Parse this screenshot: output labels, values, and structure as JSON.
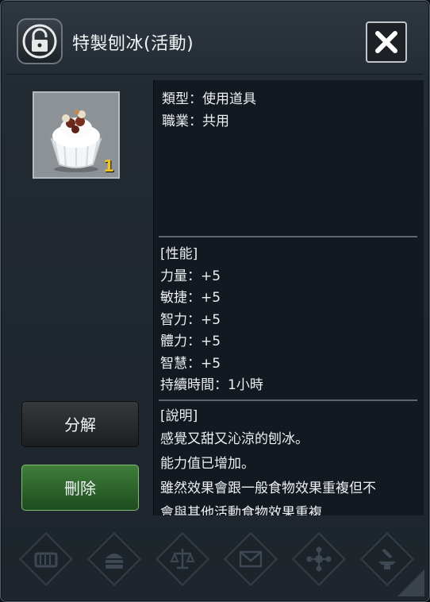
{
  "window": {
    "title": "特製刨冰(活動)",
    "icon": "lock-icon",
    "close_icon": "close-icon"
  },
  "item": {
    "icon": "shaved-ice-icon",
    "count": "1"
  },
  "buttons": {
    "dismantle": "分解",
    "delete": "刪除"
  },
  "info": {
    "type": "類型：使用道具",
    "job": "職業：共用",
    "stats_header": "[性能]",
    "stats": [
      "力量：+5",
      "敏捷：+5",
      "智力：+5",
      "體力：+5",
      "智慧：+5",
      "持續時間：1小時"
    ],
    "desc_header": "[說明]",
    "desc": [
      "感覺又甜又沁涼的刨冰。",
      "能力值已增加。",
      "雖然效果會跟一般食物效果重複但不",
      "會與其他活動食物效果重複"
    ]
  },
  "bottom_slots": [
    "ticket-icon",
    "food-icon",
    "scale-icon",
    "mail-icon",
    "cross-icon",
    "anvil-icon"
  ],
  "colors": {
    "count": "#f2c320",
    "delete_button": "#3f7e3b",
    "panel_bg": "#121920"
  }
}
